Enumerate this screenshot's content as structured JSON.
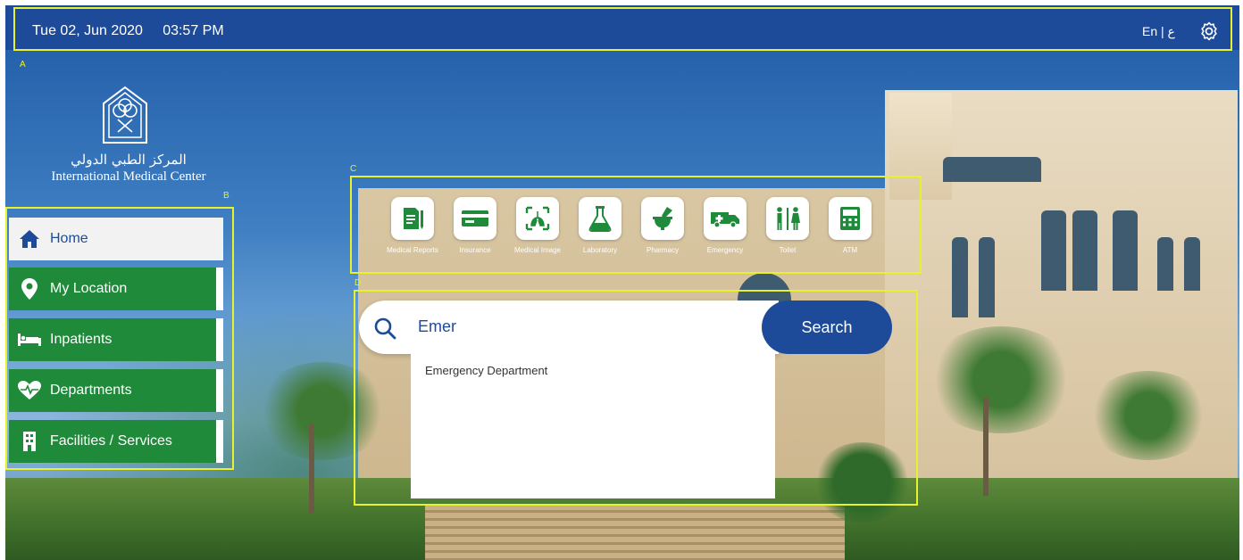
{
  "header": {
    "date": "Tue 02, Jun 2020",
    "time": "03:57 PM",
    "language_en": "En",
    "language_sep": "|",
    "language_ar": "ع",
    "settings_icon": "gear-icon"
  },
  "zone_labels": {
    "a": "A",
    "b": "B",
    "c": "C",
    "d": "D"
  },
  "logo": {
    "arabic_name": "المركز الطبي الدولي",
    "english_name": "International Medical Center"
  },
  "sidebar": {
    "items": [
      {
        "label": "Home",
        "icon": "home-icon",
        "active": true
      },
      {
        "label": "My Location",
        "icon": "location-pin-icon",
        "active": false
      },
      {
        "label": "Inpatients",
        "icon": "bed-icon",
        "active": false
      },
      {
        "label": "Departments",
        "icon": "heart-pulse-icon",
        "active": false
      },
      {
        "label": "Facilities / Services",
        "icon": "building-icon",
        "active": false
      }
    ]
  },
  "categories": [
    {
      "label": "Medical Reports",
      "icon": "medical-report-icon"
    },
    {
      "label": "Insurance",
      "icon": "insurance-card-icon"
    },
    {
      "label": "Medical Image",
      "icon": "medical-image-icon"
    },
    {
      "label": "Laboratory",
      "icon": "flask-icon"
    },
    {
      "label": "Pharmacy",
      "icon": "mortar-pestle-icon"
    },
    {
      "label": "Emergency",
      "icon": "ambulance-icon"
    },
    {
      "label": "Toilet",
      "icon": "restroom-icon"
    },
    {
      "label": "ATM",
      "icon": "atm-icon"
    }
  ],
  "search": {
    "value": "Emer",
    "button_label": "Search",
    "suggestions": [
      "Emergency Department"
    ]
  },
  "colors": {
    "header_blue": "#1e4b99",
    "nav_green": "#1f8a3a",
    "zone_outline": "#e7f12c"
  }
}
